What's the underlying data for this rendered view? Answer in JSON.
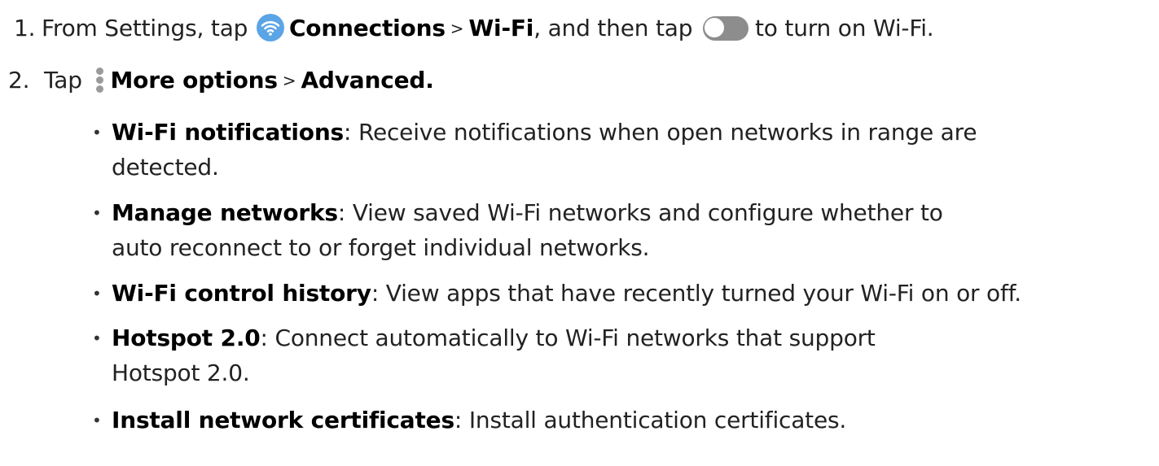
{
  "colors": {
    "wifi_icon_bg": "#5ba4e6",
    "toggle_track": "#8d8d8d",
    "more_icon": "#9a9a9a",
    "text": "#222222"
  },
  "icons": {
    "wifi": "wifi-icon",
    "toggle": "toggle-off-icon",
    "more": "more-options-icon"
  },
  "steps": [
    {
      "number": "1.",
      "part1": "From Settings, tap",
      "connections": "Connections",
      "sep": ">",
      "wifi": "Wi-Fi",
      "part2": ", and then tap",
      "part3": "to turn on Wi-Fi."
    },
    {
      "number": "2.",
      "part1": "Tap",
      "more_options": "More options",
      "sep": ">",
      "advanced": "Advanced."
    }
  ],
  "bullets": [
    {
      "term": "Wi-Fi notifications",
      "colon": ":",
      "line1": " Receive notifications when open networks in range are",
      "line2": "detected."
    },
    {
      "term": "Manage networks",
      "colon": ":",
      "line1": " View saved Wi-Fi networks and configure whether to",
      "line2": "auto reconnect to or forget individual networks."
    },
    {
      "term": "Wi-Fi control history",
      "colon": ":",
      "line1": " View apps that have recently turned your Wi-Fi on or off."
    },
    {
      "term": "Hotspot 2.0",
      "colon": ":",
      "line1": " Connect automatically to Wi-Fi networks that support",
      "line2": "Hotspot 2.0."
    },
    {
      "term": "Install network certificates",
      "colon": ":",
      "line1": " Install authentication certificates."
    }
  ]
}
